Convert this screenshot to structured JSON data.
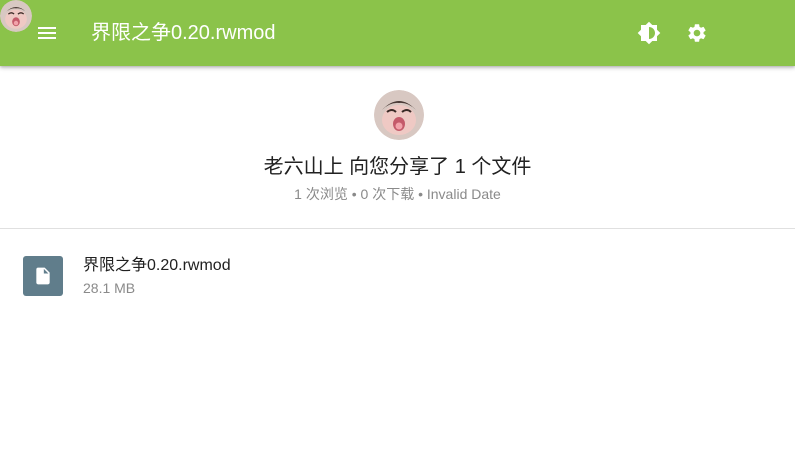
{
  "appbar": {
    "title": "界限之争0.20.rwmod",
    "icons": [
      "menu-icon",
      "brightness-icon",
      "settings-icon",
      "user-avatar"
    ],
    "color": "#8bc34a"
  },
  "share": {
    "title": "老六山上 向您分享了 1 个文件",
    "meta": "1 次浏览 • 0 次下载 • Invalid Date"
  },
  "files": [
    {
      "name": "界限之争0.20.rwmod",
      "size": "28.1 MB",
      "icon": "file-document-icon",
      "icon_color": "#607d8b"
    }
  ]
}
